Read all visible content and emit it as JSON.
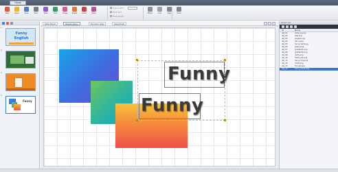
{
  "window": {
    "app_tab": "Home"
  },
  "ribbon": {
    "buttons": [
      {
        "label": "New",
        "icon": "new-doc-icon",
        "color": "#e1553d"
      },
      {
        "label": "Open",
        "icon": "folder-icon",
        "color": "#f0b429"
      },
      {
        "label": "Save",
        "icon": "floppy-icon",
        "color": "#4a7bd0"
      },
      {
        "label": "Print",
        "icon": "printer-icon",
        "color": "#6b7a8f"
      },
      {
        "label": "Slide",
        "icon": "slide-icon",
        "color": "#8e5bd6"
      },
      {
        "label": "Text",
        "icon": "text-icon",
        "color": "#3a9b5a"
      },
      {
        "label": "Image",
        "icon": "image-icon",
        "color": "#d65b8c"
      },
      {
        "label": "Shape",
        "icon": "shape-icon",
        "color": "#e07a2e"
      },
      {
        "label": "Audio",
        "icon": "audio-icon",
        "color": "#cf3f3f"
      },
      {
        "label": "Video",
        "icon": "video-icon",
        "color": "#c24a9a"
      },
      {
        "label": "Effect",
        "icon": "effect-icon",
        "color": "#8a8f99"
      },
      {
        "label": "Link",
        "icon": "link-icon",
        "color": "#9aa0aa"
      },
      {
        "label": "Align",
        "icon": "align-icon",
        "color": "#7f8793"
      },
      {
        "label": "Order",
        "icon": "order-icon",
        "color": "#7f8793"
      }
    ],
    "checks": [
      "Snap to grid",
      "Show grid",
      "Show guides"
    ]
  },
  "slides": {
    "count_labels": [
      "1",
      "2",
      "3",
      "4"
    ],
    "thumb1_text": "Funny English"
  },
  "canvas": {
    "tabs": [
      "Slide Event",
      "Object Action",
      "Function View",
      "Save/Undo"
    ],
    "text1": "Funny",
    "text2": "Funny"
  },
  "right_panel": {
    "title": "Object List",
    "col_id": "ID",
    "col_name": "Name",
    "rows": [
      {
        "id": "obj_01",
        "name": "slide_bg.png"
      },
      {
        "id": "obj_02",
        "name": "title.png"
      },
      {
        "id": "obj_03",
        "name": "english.png"
      },
      {
        "id": "obj_04",
        "name": "funny.png"
      },
      {
        "id": "obj_05",
        "name": "funny_text.png"
      },
      {
        "id": "obj_06",
        "name": "green.png"
      },
      {
        "id": "obj_07",
        "name": "gradient1.png"
      },
      {
        "id": "obj_08",
        "name": "gradient2.png"
      },
      {
        "id": "obj_09",
        "name": "rect1.png"
      },
      {
        "id": "obj_10",
        "name": "frame_txt.png"
      },
      {
        "id": "obj_11",
        "name": "funny_img.png"
      },
      {
        "id": "obj_12",
        "name": "rect2.png"
      },
      {
        "id": "obj_13",
        "name": "funny2.png"
      },
      {
        "id": "obj_14",
        "name": "funny_text2.png"
      }
    ],
    "selected_row": 13
  },
  "colors": {
    "selection": "#3a78d6",
    "handle": "#f5c518"
  }
}
